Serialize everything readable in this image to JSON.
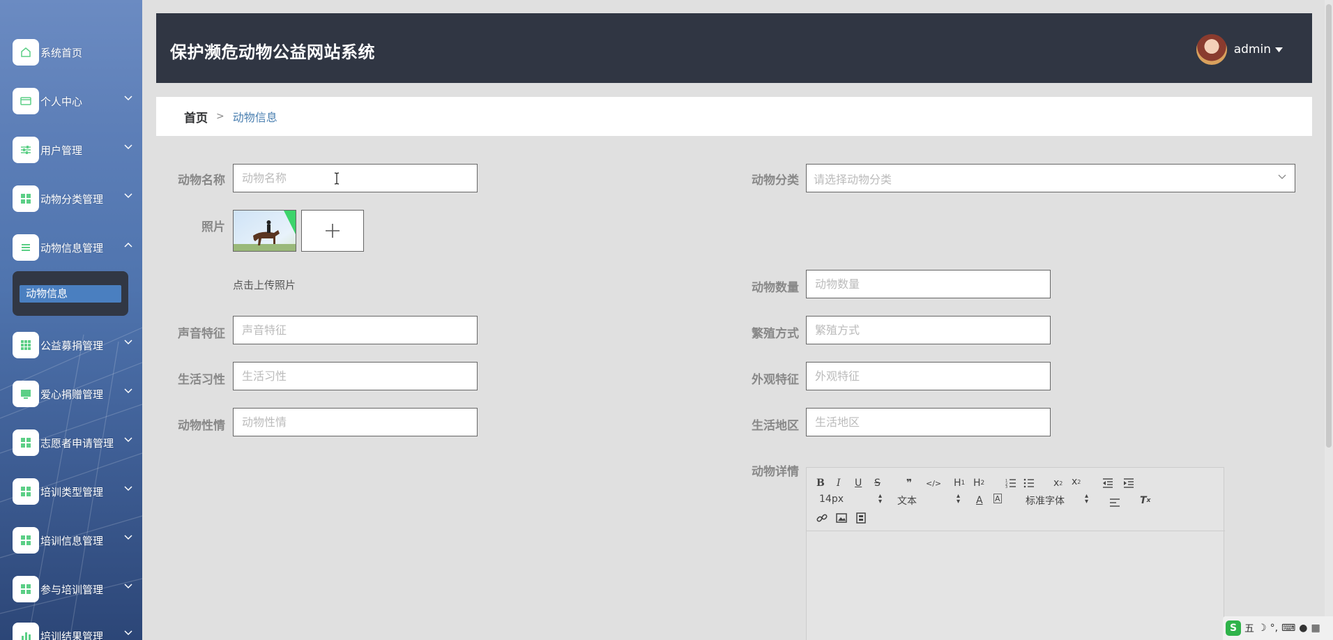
{
  "app": {
    "title": "保护濒危动物公益网站系统"
  },
  "user": {
    "name": "admin"
  },
  "sidebar": {
    "items": [
      {
        "label": "系统首页",
        "icon": "home-icon"
      },
      {
        "label": "个人中心",
        "icon": "card-icon"
      },
      {
        "label": "用户管理",
        "icon": "sliders-icon"
      },
      {
        "label": "动物分类管理",
        "icon": "grid-icon"
      },
      {
        "label": "动物信息管理",
        "icon": "list-icon"
      },
      {
        "label": "公益募捐管理",
        "icon": "table-icon"
      },
      {
        "label": "爱心捐赠管理",
        "icon": "monitor-icon"
      },
      {
        "label": "志愿者申请管理",
        "icon": "grid-icon"
      },
      {
        "label": "培训类型管理",
        "icon": "grid-icon"
      },
      {
        "label": "培训信息管理",
        "icon": "grid-icon"
      },
      {
        "label": "参与培训管理",
        "icon": "grid-icon"
      },
      {
        "label": "培训结果管理",
        "icon": "chart-icon"
      }
    ],
    "sub_item": "动物信息"
  },
  "breadcrumb": {
    "home": "首页",
    "sep": ">",
    "current": "动物信息"
  },
  "form": {
    "name_label": "动物名称",
    "name_placeholder": "动物名称",
    "category_label": "动物分类",
    "category_placeholder": "请选择动物分类",
    "photo_label": "照片",
    "photo_hint": "点击上传照片",
    "count_label": "动物数量",
    "count_placeholder": "动物数量",
    "sound_label": "声音特征",
    "sound_placeholder": "声音特征",
    "breed_label": "繁殖方式",
    "breed_placeholder": "繁殖方式",
    "habit_label": "生活习性",
    "habit_placeholder": "生活习性",
    "look_label": "外观特征",
    "look_placeholder": "外观特征",
    "temper_label": "动物性情",
    "temper_placeholder": "动物性情",
    "region_label": "生活地区",
    "region_placeholder": "生活地区",
    "detail_label": "动物详情"
  },
  "editor": {
    "font_size": "14px",
    "paragraph": "文本",
    "font_family": "标准字体"
  },
  "ime": {
    "mode": "五"
  },
  "colors": {
    "header_bg": "#303643",
    "accent": "#4a7fb0",
    "sidebar_icon": "#5ccf86"
  }
}
